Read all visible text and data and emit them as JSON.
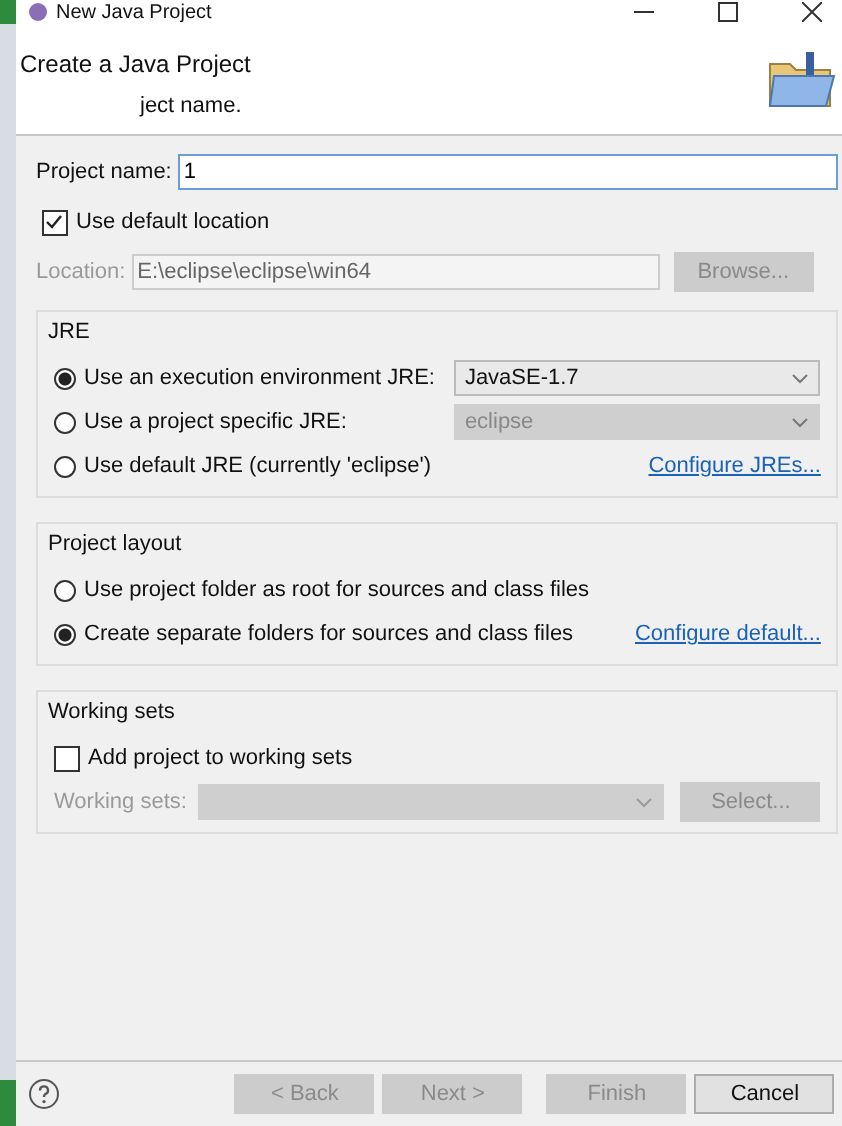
{
  "window": {
    "title": "New Java Project"
  },
  "header": {
    "title": "Create a Java Project",
    "description": "ject name."
  },
  "project_name": {
    "label": "Project name:",
    "value": "1"
  },
  "use_default_location": {
    "label": "Use default location",
    "checked": true
  },
  "location": {
    "label": "Location:",
    "value": "E:\\eclipse\\eclipse\\win64",
    "disabled": true,
    "button": "Browse..."
  },
  "jre": {
    "title": "JRE",
    "options": [
      {
        "label": "Use an execution environment JRE:",
        "selected": true,
        "kind": "combo",
        "combo": {
          "value": "JavaSE-1.7",
          "disabled": false
        }
      },
      {
        "label": "Use a project specific JRE:",
        "selected": false,
        "kind": "combo",
        "combo": {
          "value": "eclipse",
          "disabled": true
        }
      },
      {
        "label": "Use default JRE (currently 'eclipse')",
        "selected": false,
        "kind": "link",
        "link": "Configure JREs..."
      }
    ]
  },
  "project_layout": {
    "title": "Project layout",
    "options": [
      {
        "label": "Use project folder as root for sources and class files",
        "selected": false,
        "kind": "plain"
      },
      {
        "label": "Create separate folders for sources and class files",
        "selected": true,
        "kind": "link",
        "link": "Configure default..."
      }
    ]
  },
  "working_sets": {
    "title": "Working sets",
    "add": {
      "label": "Add project to working sets",
      "checked": false
    },
    "field": {
      "label": "Working sets:",
      "disabled": true
    },
    "button": "Select..."
  },
  "buttons": [
    {
      "label": "< Back",
      "disabled": true
    },
    {
      "label": "Next >",
      "disabled": true
    },
    {
      "label": "Finish",
      "disabled": true
    },
    {
      "label": "Cancel",
      "disabled": false
    }
  ]
}
